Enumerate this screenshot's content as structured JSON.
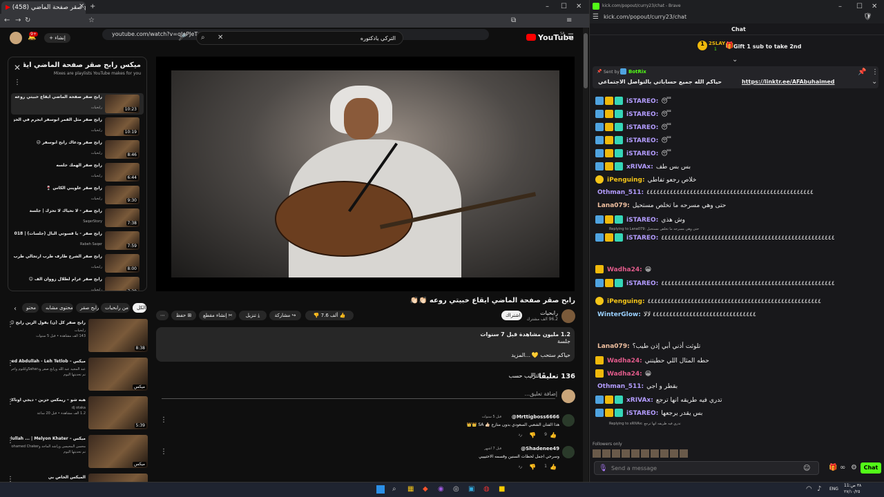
{
  "youtube": {
    "tab_title": "(458) رابح صقر صفحة الماضي ...",
    "url": "youtube.com/watch?v=qJePJeTzDWI&list=RDqJePJeTzDWI&start_radio=1",
    "search_value": "التركي يادكتوره",
    "create_label": "إنشاء",
    "notif_count": "9+",
    "logo_text": "YouTube",
    "logo_region": "SA",
    "playlist": {
      "title": "ميكس رابح صقر صفحة الماضي ايقا...",
      "subtitle": "Mixes are playlists YouTube makes for you",
      "items": [
        {
          "title": "رابح صقر صفحة الماضي ايقاع خبيتي روعه 👏🏻",
          "channel": "رابحيات",
          "duration": "10:23"
        },
        {
          "title": "رابح صقر مثل القمر ابوسفر ابجرم في الحزن",
          "channel": "رابحيات",
          "duration": "10:19"
        },
        {
          "title": "رابح صقر ودعاك رابح ابوسفر 😥",
          "channel": "رابحيات",
          "duration": "8:46"
        },
        {
          "title": "رابح صقر الهمك جلسه",
          "channel": "رابحيات",
          "duration": "6:44"
        },
        {
          "title": "رابح صقر علويني الكاس 🍷",
          "channel": "رابحيات",
          "duration": "9:30"
        },
        {
          "title": "رابح صقر - لا نحياك لا تحزك | جلسة",
          "channel": "SaqerStory",
          "duration": "7:38"
        },
        {
          "title": "رابح صقر - يا قسوتي البال (جلسات) | 2018",
          "channel": "Rabeh Saqer",
          "duration": "7:59"
        },
        {
          "title": "رابح صقر الشرع طارف طرب ارتجالي طرب",
          "channel": "رابحيات",
          "duration": "8:00"
        },
        {
          "title": "رابح صقر غرام لطلال زووان آلف 😊",
          "channel": "رابحيات",
          "duration": "7:38"
        }
      ]
    },
    "chips": [
      "الكل",
      "من رابحيات",
      "رابح صقر",
      "محتوى مشابه",
      "محتو"
    ],
    "recommended": [
      {
        "title": "رابح صقر كل (ن) يقول الزين رابح 😊",
        "channel": "رابحيات",
        "meta": "143 ألف مشاهدة • قبل 5 سنوات",
        "duration": "8:38"
      },
      {
        "title": "ميكس – Abdul Majeed Abdullah - Leh Tetlob | عبدالمجيد عبدالله - ليه تطلب",
        "channel": "عبد المجيد عبد الله ورابح صقر ودSaharوكلثوم وآخرين",
        "meta": "تم تحديثها اليوم",
        "duration": "ميكس"
      },
      {
        "title": "هبه شو – ريمكس حزين - ديجي اوتاكا Dj... Sasa Sheno _ Remix Hazen",
        "channel": "dj otaka",
        "meta": "1.2 ألف مشاهدة • قبل 20 ساعة",
        "duration": "5:39"
      },
      {
        "title": "ميكس – Abdul Majeed Abdullah ... | Melyon Khater | عبد المجيد عبد الله",
        "channel": "محسن المحيسن وراشد الماجد وMohamed Chaker",
        "meta": "تم تحديثها اليوم",
        "duration": "ميكس"
      },
      {
        "title": "الميكس الخاص بي",
        "channel": "",
        "meta": "",
        "duration": ""
      }
    ],
    "video": {
      "title": "رابح صقر صفحة الماضي ايقاع خبيتي روعه 👏🏻👏🏻",
      "channel": "رابحيات",
      "subs": "96.2 ألف مشترك",
      "subscribe_label": "اشتراك",
      "likes": "7.6 ألف",
      "share": "مشاركة",
      "download": "تنزيل",
      "clip": "إنشاء مقطع",
      "save": "حفظ",
      "views": "1.2 مليون مشاهدة قبل 7 سنوات",
      "desc_line": "جلسة",
      "desc_more": "...المزيد",
      "desc_greeting": "حياكم ستحب 💛"
    },
    "comments": {
      "count": "136 تعليقًا",
      "sort": "الترتيب حسب",
      "add_placeholder": "إضافة تعليق...",
      "items": [
        {
          "user": "@Mrttigboss6666",
          "time": "قبل 5 سنوات",
          "text": "هذا الفنان الشعبي السعودي بدون منازع 👍🏻 SA 👑👑",
          "likes": "9",
          "reply": "رد"
        },
        {
          "user": "@Shadenee49",
          "time": "قبل 7 أشهر",
          "text": "وسرحي اجمل لحظات السنين وقسمه الاحتيييي",
          "likes": "1",
          "reply": "رد"
        }
      ]
    },
    "accent": "#ff0000"
  },
  "kick": {
    "window_title": "kick.com/popout/curry23/chat - Brave",
    "url": "kick.com/popout/curry23/chat",
    "chat_title": "Chat",
    "gift_user": "2SLAY",
    "gift_count": "1",
    "gift_text": "Gift 1 sub to take 2nd",
    "pinned_sent_by": "Sent by",
    "pinned_bot": "BotRix",
    "pinned_text": "حياكم الله جميع حساباتي بالتواصل الاجتماعي",
    "pinned_link": "https://linktr.ee/AFAbuhaimed",
    "messages": [
      {
        "user": "iSTAREO:",
        "text": "😴",
        "color": "#b39cff"
      },
      {
        "user": "iSTAREO:",
        "text": "😴",
        "color": "#b39cff"
      },
      {
        "user": "iSTAREO:",
        "text": "😴",
        "color": "#b39cff"
      },
      {
        "user": "iSTAREO:",
        "text": "😴",
        "color": "#b39cff"
      },
      {
        "user": "iSTAREO:",
        "text": "😴",
        "color": "#b39cff"
      },
      {
        "user": "xRIVAx:",
        "text": "بس بس طف",
        "color": "#b39cff"
      },
      {
        "user": "iPenguing:",
        "text": "خلاص رجعو تفاطي",
        "color": "#f5c518"
      },
      {
        "user": "Othman_511:",
        "text": "٤٤٤٤٤٤٤٤٤٤٤٤٤٤٤٤٤٤٤٤٤٤٤٤٤٤٤٤٤٤٤٤٤٤٤٤٤٤٤٤٤٤٤٤٤٤٤٤٤٤",
        "color": "#b39cff"
      },
      {
        "user": "Lana079:",
        "text": "حتى وهي مسرحه ما تخلص مستحيل",
        "color": "#f0c0a0"
      },
      {
        "user": "iSTAREO:",
        "text": "وش هذي",
        "color": "#b39cff"
      },
      {
        "user": "iSTAREO:",
        "text": "٤٤٤٤٤٤٤٤٤٤٤٤٤٤٤٤٤٤٤٤٤٤٤٤٤٤٤٤٤٤٤٤٤٤٤٤٤٤٤٤٤٤٤٤٤٤٤٤٤٤٤٤",
        "color": "#b39cff"
      },
      {
        "user": "Wadha24:",
        "text": "😀",
        "color": "#e05a8a"
      },
      {
        "user": "iSTAREO:",
        "text": "٤٤٤٤٤٤٤٤٤٤٤٤٤٤٤٤٤٤٤٤٤٤٤٤٤٤٤٤٤٤٤٤٤٤٤٤٤٤٤٤٤٤٤٤٤٤٤٤٤٤٤٤",
        "color": "#b39cff"
      },
      {
        "user": "iPenguing:",
        "text": "٤٤٤٤٤٤٤٤٤٤٤٤٤٤٤٤٤٤٤٤٤٤٤٤٤٤٤٤٤٤٤٤٤٤٤٤٤٤٤٤٤٤٤٤٤٤٤٤٤٤٤٤",
        "color": "#f5c518"
      },
      {
        "user": "WinterGlow:",
        "text": "٤٤٤٤٤٤٤٤٤٤٤٤٤٤٤٤٤٤٤٤٤٤٤٤٤٤٤٤٤٤٤ لالا",
        "color": "#9ad0ff"
      },
      {
        "user": "Lana079:",
        "text": "تلوثت أذني أبي إذن طيب؟",
        "color": "#f0c0a0"
      },
      {
        "user": "Wadha24:",
        "text": "حطه المثال اللي حطيتني",
        "color": "#e05a8a"
      },
      {
        "user": "Wadha24:",
        "text": "😀",
        "color": "#e05a8a"
      },
      {
        "user": "Othman_511:",
        "text": "بقطر و اجي",
        "color": "#b39cff"
      },
      {
        "user": "xRIVAx:",
        "text": "تدري فيه طريقه انها ترجع",
        "color": "#b39cff"
      },
      {
        "user": "iSTAREO:",
        "text": "بس يقدر يرجعها",
        "color": "#b39cff"
      }
    ],
    "reply1": "Replying to Lana079: حتى وهي مسرحه ما تخلص مستحيل",
    "reply2": "Replying to xRIVAx: تدري فيه طريقه انها ترجع",
    "followers_only": "Followers only",
    "input_placeholder": "Send a message",
    "chat_button": "Chat",
    "accent": "#53fc18"
  },
  "taskbar": {
    "lang": "ENG",
    "time": "11:٣٨ ص",
    "date": "٢٧/١٠/٢٥"
  }
}
